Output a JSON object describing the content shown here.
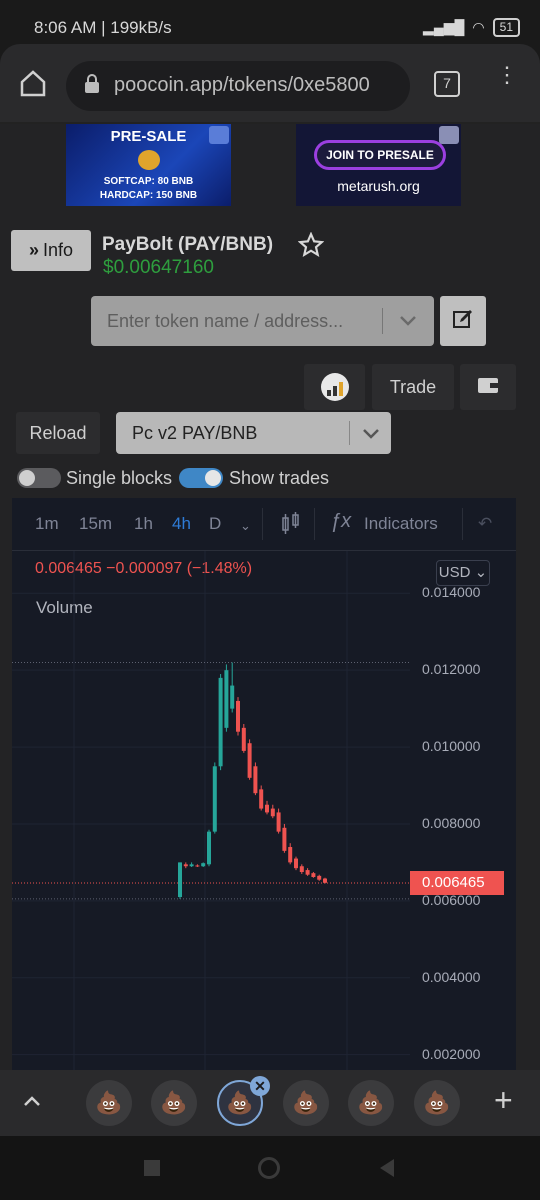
{
  "status": {
    "time": "8:06 AM | 199kB/s",
    "battery": "51"
  },
  "browser": {
    "url": "poocoin.app/tokens/0xe5800",
    "tab_count": "7"
  },
  "banners": {
    "left": {
      "title": "PRE-SALE",
      "line1": "SOFTCAP: 80 BNB",
      "line2": "HARDCAP: 150 BNB"
    },
    "right": {
      "button": "JOIN TO PRESALE",
      "site": "metarush.org"
    }
  },
  "token": {
    "info_label": "Info",
    "name": "PayBolt (PAY/BNB)",
    "price": "$0.00647160"
  },
  "search": {
    "placeholder": "Enter token name / address..."
  },
  "actions": {
    "trade_label": "Trade",
    "reload_label": "Reload",
    "pair_selected": "Pc v2 PAY/BNB"
  },
  "toggles": {
    "single_blocks": "Single blocks",
    "show_trades": "Show trades",
    "show_trades_on": true,
    "single_blocks_on": false
  },
  "chart_toolbar": {
    "timeframes": [
      "1m",
      "15m",
      "1h",
      "4h",
      "D"
    ],
    "active": "4h",
    "indicators": "Indicators"
  },
  "chart": {
    "quote": "0.006465 −0.000097 (−1.48%)",
    "currency": "USD",
    "volume_label": "Volume",
    "last_price_tag": "0.006465",
    "colors": {
      "up": "#26a69a",
      "down": "#ef5350",
      "bg": "#161a25"
    }
  },
  "chart_data": {
    "type": "candlestick",
    "y_axis_ticks": [
      "0.014000",
      "0.012000",
      "0.010000",
      "0.008000",
      "0.006000",
      "0.004000",
      "0.002000"
    ],
    "ylim": [
      0.0016,
      0.0151
    ],
    "last_price": 0.006465,
    "candles": [
      {
        "o": 0.0061,
        "c": 0.007,
        "h": 0.007,
        "l": 0.00605
      },
      {
        "o": 0.00695,
        "c": 0.0069,
        "h": 0.007,
        "l": 0.00685
      },
      {
        "o": 0.0069,
        "c": 0.00695,
        "h": 0.007,
        "l": 0.00688
      },
      {
        "o": 0.00692,
        "c": 0.0069,
        "h": 0.00695,
        "l": 0.00688
      },
      {
        "o": 0.0069,
        "c": 0.00698,
        "h": 0.007,
        "l": 0.00688
      },
      {
        "o": 0.00695,
        "c": 0.0078,
        "h": 0.00785,
        "l": 0.0069
      },
      {
        "o": 0.0078,
        "c": 0.0095,
        "h": 0.0096,
        "l": 0.00775
      },
      {
        "o": 0.0095,
        "c": 0.0118,
        "h": 0.0119,
        "l": 0.0094
      },
      {
        "o": 0.0105,
        "c": 0.012,
        "h": 0.01215,
        "l": 0.0104
      },
      {
        "o": 0.011,
        "c": 0.0116,
        "h": 0.0122,
        "l": 0.0109
      },
      {
        "o": 0.0112,
        "c": 0.0104,
        "h": 0.0113,
        "l": 0.0103
      },
      {
        "o": 0.0105,
        "c": 0.0099,
        "h": 0.0106,
        "l": 0.00985
      },
      {
        "o": 0.0101,
        "c": 0.0092,
        "h": 0.0102,
        "l": 0.00915
      },
      {
        "o": 0.0095,
        "c": 0.0088,
        "h": 0.0096,
        "l": 0.00875
      },
      {
        "o": 0.0089,
        "c": 0.0084,
        "h": 0.009,
        "l": 0.00835
      },
      {
        "o": 0.0085,
        "c": 0.0083,
        "h": 0.0086,
        "l": 0.00825
      },
      {
        "o": 0.0084,
        "c": 0.0082,
        "h": 0.0085,
        "l": 0.00815
      },
      {
        "o": 0.0083,
        "c": 0.0078,
        "h": 0.0084,
        "l": 0.00775
      },
      {
        "o": 0.0079,
        "c": 0.0073,
        "h": 0.008,
        "l": 0.00725
      },
      {
        "o": 0.0074,
        "c": 0.007,
        "h": 0.0075,
        "l": 0.00695
      },
      {
        "o": 0.0071,
        "c": 0.00685,
        "h": 0.00715,
        "l": 0.0068
      },
      {
        "o": 0.0069,
        "c": 0.00675,
        "h": 0.00695,
        "l": 0.0067
      },
      {
        "o": 0.0068,
        "c": 0.00668,
        "h": 0.00685,
        "l": 0.00665
      },
      {
        "o": 0.00672,
        "c": 0.00662,
        "h": 0.00675,
        "l": 0.0066
      },
      {
        "o": 0.00665,
        "c": 0.00655,
        "h": 0.00668,
        "l": 0.00652
      },
      {
        "o": 0.00658,
        "c": 0.00647,
        "h": 0.0066,
        "l": 0.00645
      }
    ]
  },
  "tabs": {
    "count": 6,
    "emoji": "💩",
    "add": "+"
  }
}
